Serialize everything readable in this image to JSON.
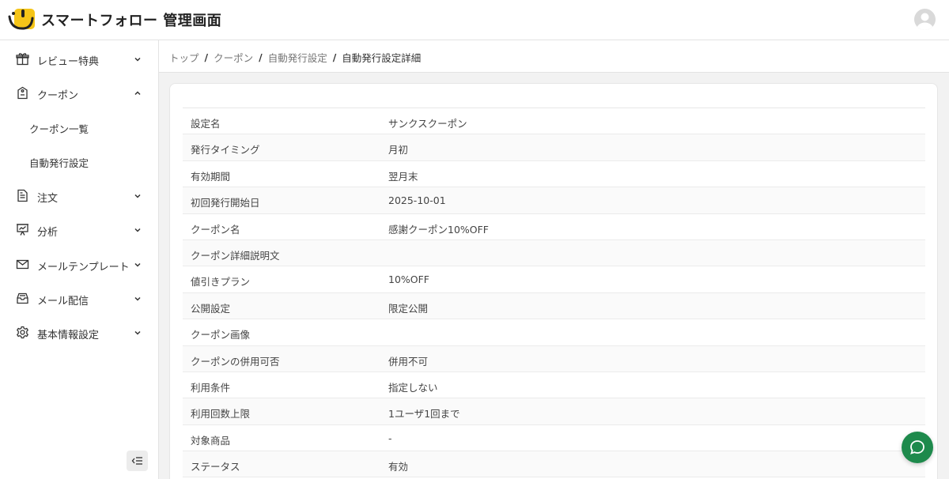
{
  "header": {
    "app_title": "スマートフォロー 管理画面"
  },
  "sidebar": {
    "items": [
      {
        "label": "レビュー特典",
        "icon": "gift-icon",
        "expanded": false
      },
      {
        "label": "クーポン",
        "icon": "coupon-icon",
        "expanded": true,
        "children": [
          {
            "label": "クーポン一覧"
          },
          {
            "label": "自動発行設定"
          }
        ]
      },
      {
        "label": "注文",
        "icon": "document-icon",
        "expanded": false
      },
      {
        "label": "分析",
        "icon": "presentation-chart-icon",
        "expanded": false
      },
      {
        "label": "メールテンプレート",
        "icon": "mail-icon",
        "expanded": false
      },
      {
        "label": "メール配信",
        "icon": "inbox-icon",
        "expanded": false
      },
      {
        "label": "基本情報設定",
        "icon": "gear-icon",
        "expanded": false
      }
    ]
  },
  "breadcrumb": {
    "items": [
      "トップ",
      "クーポン",
      "自動発行設定"
    ],
    "current": "自動発行設定詳細"
  },
  "detail": {
    "rows": [
      {
        "label": "設定名",
        "value": "サンクスクーポン"
      },
      {
        "label": "発行タイミング",
        "value": "月初"
      },
      {
        "label": "有効期間",
        "value": "翌月末"
      },
      {
        "label": "初回発行開始日",
        "value": "2025-10-01"
      },
      {
        "label": "クーポン名",
        "value": "感謝クーポン10%OFF"
      },
      {
        "label": "クーポン詳細説明文",
        "value": ""
      },
      {
        "label": "値引きプラン",
        "value": "10%OFF"
      },
      {
        "label": "公開設定",
        "value": "限定公開"
      },
      {
        "label": "クーポン画像",
        "value": ""
      },
      {
        "label": "クーポンの併用可否",
        "value": "併用不可"
      },
      {
        "label": "利用条件",
        "value": "指定しない"
      },
      {
        "label": "利用回数上限",
        "value": "1ユーザ1回まで"
      },
      {
        "label": "対象商品",
        "value": "-"
      },
      {
        "label": "ステータス",
        "value": "有効"
      }
    ]
  },
  "colors": {
    "logo_yellow": "#f5c518",
    "chat_green": "#1e8a4c"
  }
}
